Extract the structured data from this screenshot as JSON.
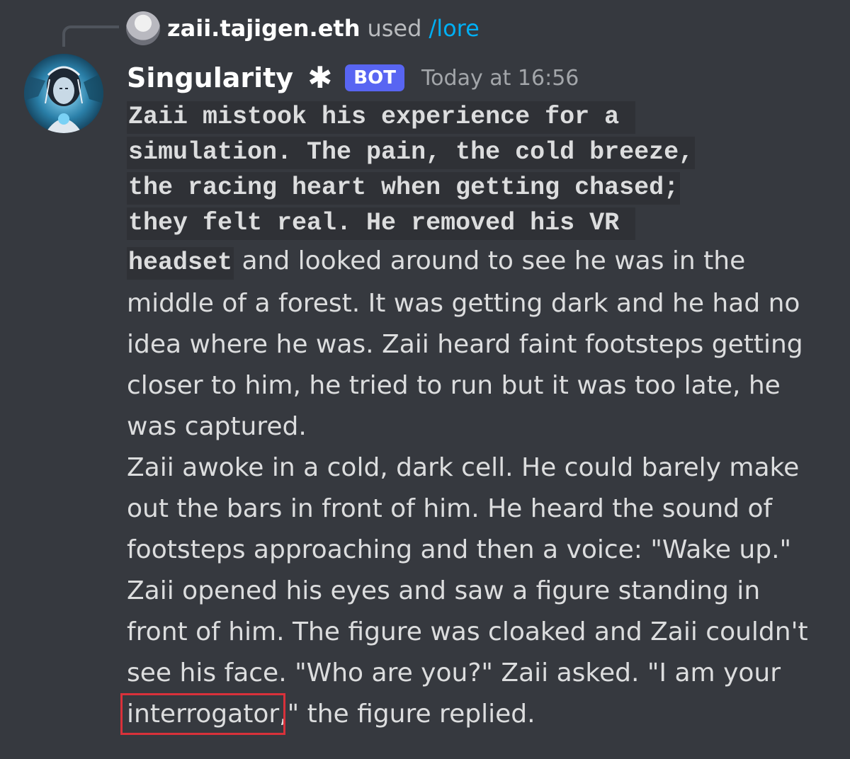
{
  "reply": {
    "avatar_icon": "user-avatar",
    "user": "zaii.tajigen.eth",
    "used": "used",
    "command": "/lore"
  },
  "message": {
    "bot_name": "Singularity",
    "badge_icon": "asterisk-icon",
    "bot_star": "✱",
    "bot_tag": "BOT",
    "timestamp": "Today at 16:56",
    "code_lines": [
      "Zaii mistook his experience for a ",
      "simulation. The pain, the cold breeze,",
      "the racing heart when getting chased;",
      "they felt real. He removed his VR ",
      "headset"
    ],
    "text_lines": [
      " and looked around to see he was in the",
      "middle of a forest. It was getting dark and he had no",
      "idea where he was. Zaii heard faint footsteps getting",
      "closer to him, he tried to run but it was too late, he",
      "was captured.",
      "Zaii awoke in a cold, dark cell. He could barely make",
      "out the bars in front of him. He heard the sound of",
      "footsteps approaching and then a voice: \"Wake up.\"",
      "Zaii opened his eyes and saw a figure standing in",
      "front of him. The figure was cloaked and Zaii couldn't",
      "see his face. \"Who are you?\" Zaii asked. \"I am your"
    ],
    "highlighted_word": "interrogator",
    "last_line_rest": ",\" the figure replied.",
    "highlight_color": "#d9313a"
  },
  "colors": {
    "background": "#36393f",
    "bot_tag": "#5865f2",
    "command": "#00aff4",
    "code_background": "#2f3136"
  }
}
